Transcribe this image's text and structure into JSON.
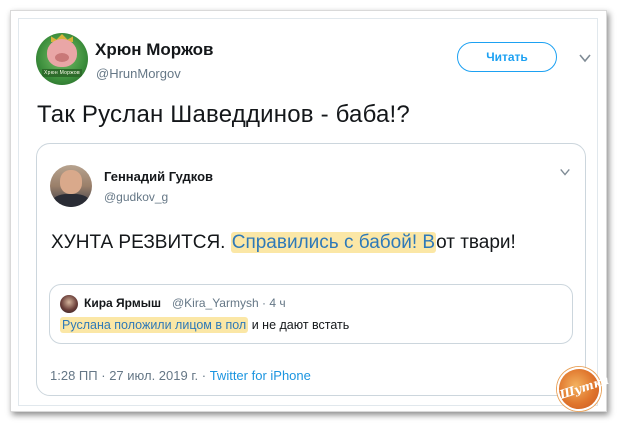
{
  "tweet": {
    "author_name": "Хрюн Моржов",
    "author_handle": "@HrunMorgov",
    "follow_label": "Читать",
    "avatar_caption": "Хрюн Моржов",
    "text": "Так Руслан Шаведдинов - баба!?"
  },
  "quoted": {
    "author_name": "Геннадий Гудков",
    "author_handle": "@gudkov_g",
    "text_before": "ХУНТА РЕЗВИТСЯ. ",
    "text_highlight": "Справились с бабой! В",
    "text_after": "от твари!",
    "highlight_color": "#fbe7a6"
  },
  "nested": {
    "author_name": "Кира Ярмыш",
    "author_handle": "@Kira_Yarmysh",
    "time": "4 ч",
    "text_highlight": "Руслана положили лицом в пол",
    "text_after": " и не дают встать"
  },
  "meta": {
    "time": "1:28 ПП",
    "date": "27 июл. 2019 г.",
    "separator": "·",
    "client": "Twitter for iPhone"
  },
  "icons": {
    "chevron": "chevron-down-icon",
    "badge": "watermark-badge"
  },
  "badge_text": "Шутка",
  "colors": {
    "accent": "#1da1f2",
    "link": "#1b95e0",
    "muted": "#657786",
    "badge": "#e0762d"
  }
}
